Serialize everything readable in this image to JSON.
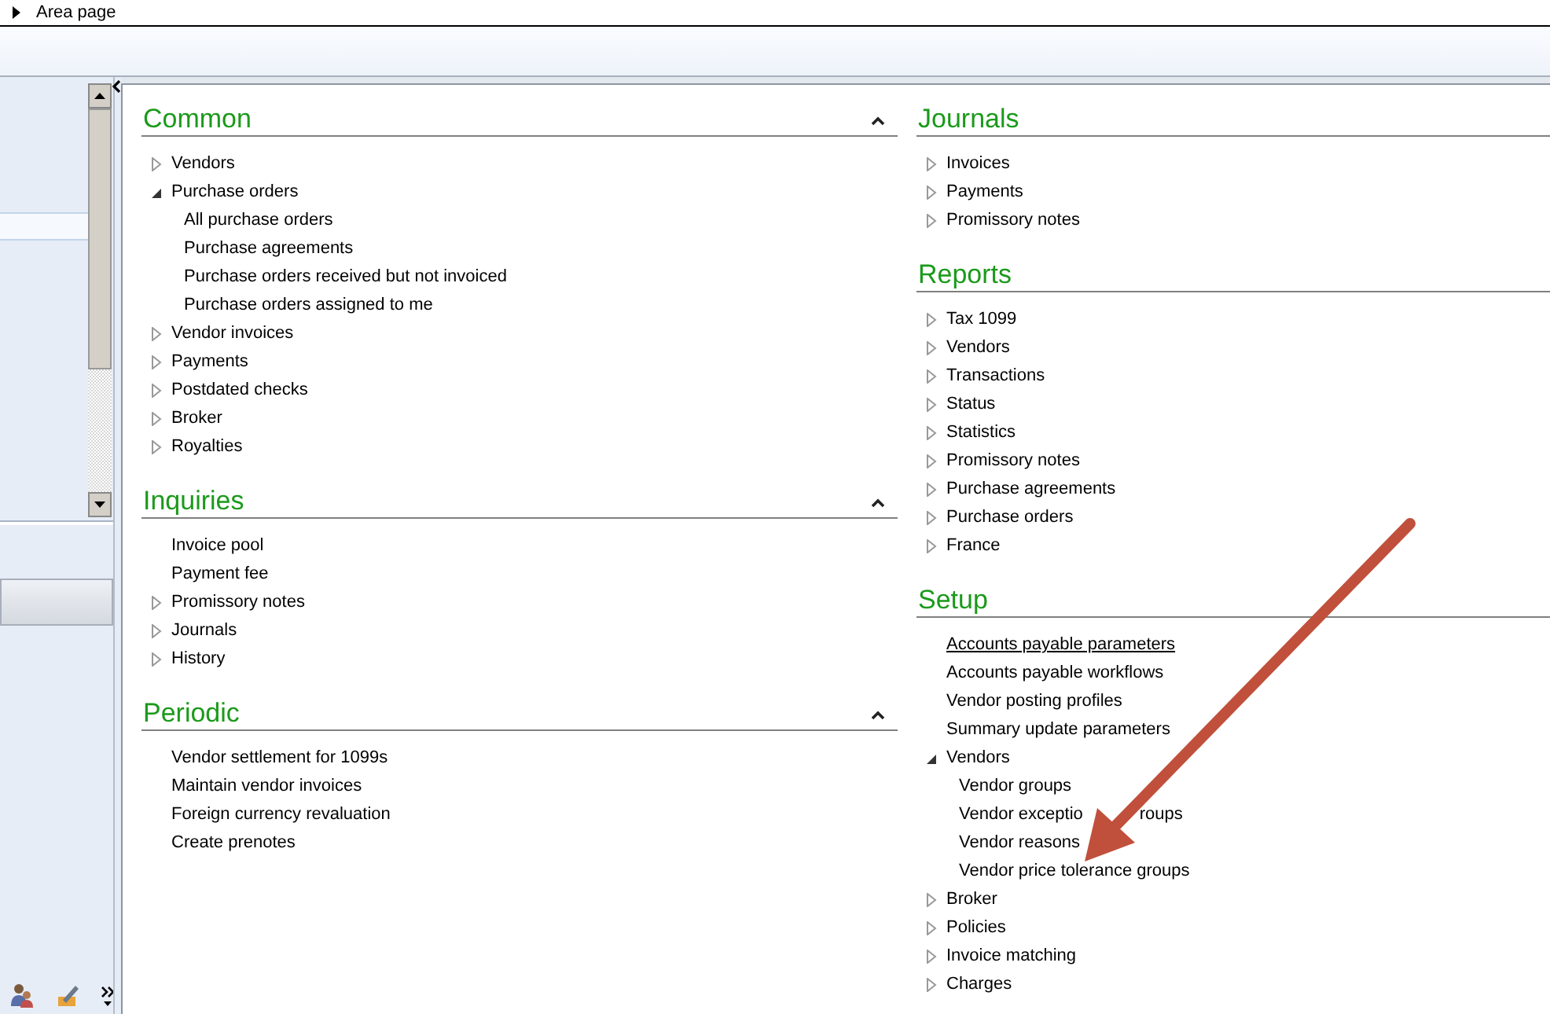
{
  "breadcrumb": {
    "label": "Area page"
  },
  "columns": [
    [
      {
        "title": "Common",
        "collapse_button": true,
        "items": [
          {
            "label": "Vendors",
            "expanded": false
          },
          {
            "label": "Purchase orders",
            "expanded": true,
            "children": [
              {
                "label": "All purchase orders"
              },
              {
                "label": "Purchase agreements"
              },
              {
                "label": "Purchase orders received but not invoiced"
              },
              {
                "label": "Purchase orders assigned to me"
              }
            ]
          },
          {
            "label": "Vendor invoices",
            "expanded": false
          },
          {
            "label": "Payments",
            "expanded": false
          },
          {
            "label": "Postdated checks",
            "expanded": false
          },
          {
            "label": "Broker",
            "expanded": false
          },
          {
            "label": "Royalties",
            "expanded": false
          }
        ]
      },
      {
        "title": "Inquiries",
        "collapse_button": true,
        "items": [
          {
            "label": "Invoice pool"
          },
          {
            "label": "Payment fee"
          },
          {
            "label": "Promissory notes",
            "expanded": false
          },
          {
            "label": "Journals",
            "expanded": false
          },
          {
            "label": "History",
            "expanded": false
          }
        ]
      },
      {
        "title": "Periodic",
        "collapse_button": true,
        "items": [
          {
            "label": "Vendor settlement for 1099s"
          },
          {
            "label": "Maintain vendor invoices"
          },
          {
            "label": "Foreign currency revaluation"
          },
          {
            "label": "Create prenotes"
          }
        ]
      }
    ],
    [
      {
        "title": "Journals",
        "items": [
          {
            "label": "Invoices",
            "expanded": false
          },
          {
            "label": "Payments",
            "expanded": false
          },
          {
            "label": "Promissory notes",
            "expanded": false
          }
        ]
      },
      {
        "title": "Reports",
        "items": [
          {
            "label": "Tax 1099",
            "expanded": false
          },
          {
            "label": "Vendors",
            "expanded": false
          },
          {
            "label": "Transactions",
            "expanded": false
          },
          {
            "label": "Status",
            "expanded": false
          },
          {
            "label": "Statistics",
            "expanded": false
          },
          {
            "label": "Promissory notes",
            "expanded": false
          },
          {
            "label": "Purchase agreements",
            "expanded": false
          },
          {
            "label": "Purchase orders",
            "expanded": false
          },
          {
            "label": "France",
            "expanded": false
          }
        ]
      },
      {
        "title": "Setup",
        "items": [
          {
            "label": "Accounts payable parameters",
            "hovered": true
          },
          {
            "label": "Accounts payable workflows",
            "hovered": false
          },
          {
            "label": "Vendor posting profiles",
            "hovered": false
          },
          {
            "label": "Summary update parameters",
            "hovered": false
          },
          {
            "label": "Vendors",
            "expanded": true,
            "hovered": false,
            "children": [
              {
                "label": "Vendor groups",
                "hovered": false
              },
              {
                "label": "Vendor exceptio",
                "covered_rest": "roups",
                "hovered": false
              },
              {
                "label": "Vendor reasons",
                "hovered": false
              },
              {
                "label": "Vendor price tolerance groups",
                "hovered": false
              }
            ]
          },
          {
            "label": "Broker",
            "expanded": false,
            "hovered": false
          },
          {
            "label": "Policies",
            "expanded": false,
            "hovered": false
          },
          {
            "label": "Invoice matching",
            "expanded": false,
            "hovered": false
          },
          {
            "label": "Charges",
            "expanded": false,
            "hovered": false
          }
        ]
      }
    ]
  ]
}
